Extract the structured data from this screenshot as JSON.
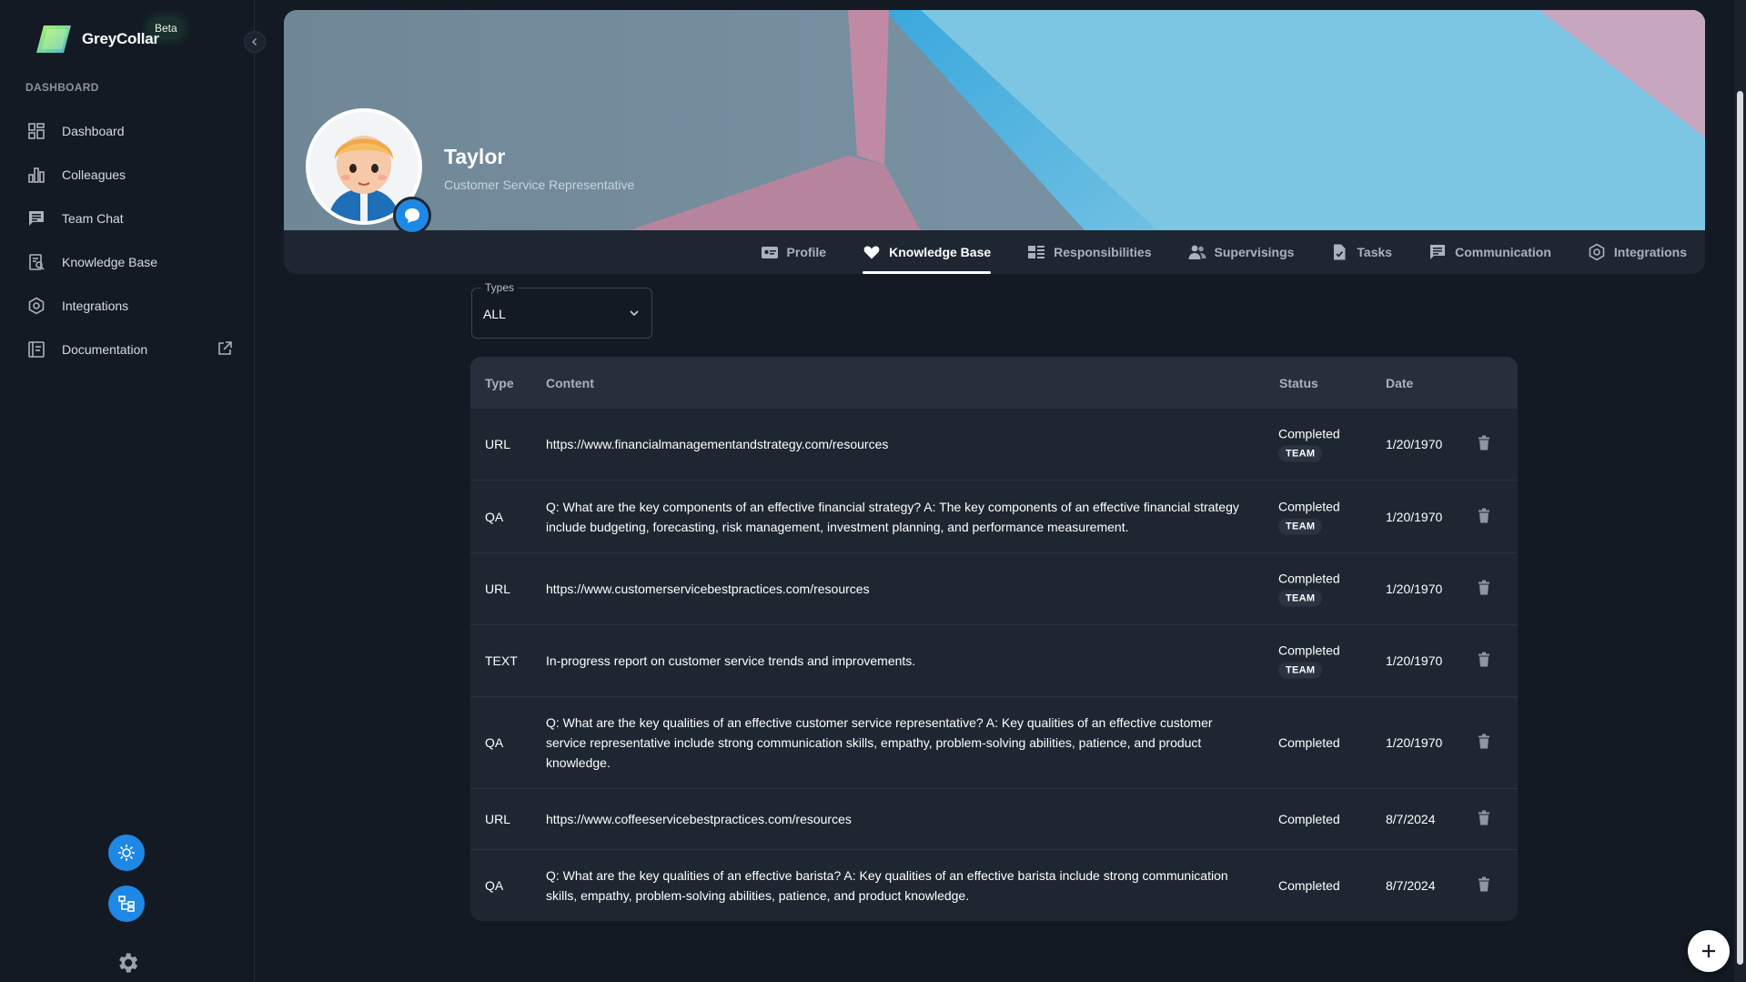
{
  "brand": {
    "name": "GreyCollar",
    "badge": "Beta"
  },
  "sidebar": {
    "section_label": "DASHBOARD",
    "items": [
      {
        "label": "Dashboard",
        "icon": "dashboard-icon"
      },
      {
        "label": "Colleagues",
        "icon": "bar-chart-icon"
      },
      {
        "label": "Team Chat",
        "icon": "chat-icon"
      },
      {
        "label": "Knowledge Base",
        "icon": "knowledge-icon"
      },
      {
        "label": "Integrations",
        "icon": "integrations-icon"
      },
      {
        "label": "Documentation",
        "icon": "documentation-icon"
      }
    ]
  },
  "profile": {
    "name": "Taylor",
    "role": "Customer Service Representative"
  },
  "tabs": [
    {
      "label": "Profile",
      "icon": "profile-card-icon"
    },
    {
      "label": "Knowledge Base",
      "icon": "heart-icon"
    },
    {
      "label": "Responsibilities",
      "icon": "responsibilities-icon"
    },
    {
      "label": "Supervisings",
      "icon": "people-icon"
    },
    {
      "label": "Tasks",
      "icon": "task-icon"
    },
    {
      "label": "Communication",
      "icon": "message-icon"
    },
    {
      "label": "Integrations",
      "icon": "integrations-icon"
    }
  ],
  "active_tab": "Knowledge Base",
  "filter": {
    "legend": "Types",
    "value": "ALL"
  },
  "table": {
    "headers": {
      "type": "Type",
      "content": "Content",
      "status": "Status",
      "date": "Date"
    },
    "rows": [
      {
        "type": "URL",
        "content": "https://www.financialmanagementandstrategy.com/resources",
        "status": "Completed",
        "tag": "TEAM",
        "date": "1/20/1970"
      },
      {
        "type": "QA",
        "content": "Q: What are the key components of an effective financial strategy? A: The key components of an effective financial strategy include budgeting, forecasting, risk management, investment planning, and performance measurement.",
        "status": "Completed",
        "tag": "TEAM",
        "date": "1/20/1970"
      },
      {
        "type": "URL",
        "content": "https://www.customerservicebestpractices.com/resources",
        "status": "Completed",
        "tag": "TEAM",
        "date": "1/20/1970"
      },
      {
        "type": "TEXT",
        "content": "In-progress report on customer service trends and improvements.",
        "status": "Completed",
        "tag": "TEAM",
        "date": "1/20/1970"
      },
      {
        "type": "QA",
        "content": "Q: What are the key qualities of an effective customer service representative? A: Key qualities of an effective customer service representative include strong communication skills, empathy, problem-solving abilities, patience, and product knowledge.",
        "status": "Completed",
        "tag": "",
        "date": "1/20/1970"
      },
      {
        "type": "URL",
        "content": "https://www.coffeeservicebestpractices.com/resources",
        "status": "Completed",
        "tag": "",
        "date": "8/7/2024"
      },
      {
        "type": "QA",
        "content": "Q: What are the key qualities of an effective barista? A: Key qualities of an effective barista include strong communication skills, empathy, problem-solving abilities, patience, and product knowledge.",
        "status": "Completed",
        "tag": "",
        "date": "8/7/2024"
      }
    ]
  },
  "colors": {
    "accent": "#1e88e5",
    "background": "#131a24",
    "card": "#1e2632"
  }
}
